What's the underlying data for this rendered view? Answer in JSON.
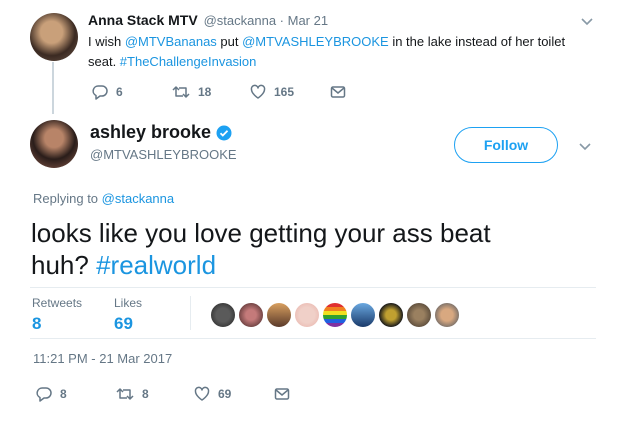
{
  "parent_tweet": {
    "display_name": "Anna Stack MTV",
    "handle": "@stackanna",
    "separator": " · ",
    "date": "Mar 21",
    "text_line1_prefix": "I wish ",
    "mention1": "@MTVBananas",
    "text_mid": " put ",
    "mention2": "@MTVASHLEYBROOKE",
    "text_line1_suffix": " in the lake instead of her toilet",
    "text_line2_prefix": "seat. ",
    "hashtag": "#TheChallengeInvasion",
    "reply_count": "6",
    "retweet_count": "18",
    "like_count": "165"
  },
  "main_tweet": {
    "display_name": "ashley brooke",
    "handle": "@MTVASHLEYBROOKE",
    "follow_label": "Follow",
    "replying_prefix": "Replying to ",
    "replying_handle": "@stackanna",
    "text_line1": "looks like you love getting your ass beat",
    "text_line2_prefix": "huh? ",
    "hashtag": "#realworld",
    "stats": {
      "retweets_label": "Retweets",
      "retweets_value": "8",
      "likes_label": "Likes",
      "likes_value": "69"
    },
    "timestamp": "11:21 PM - 21 Mar 2017",
    "reply_count": "8",
    "retweet_count": "8",
    "like_count": "69"
  },
  "colors": {
    "accent": "#1b95e0",
    "follow_border": "#1da1f2",
    "muted": "#657786",
    "verified": "#1da1f2"
  },
  "icons": [
    "chevron-down-icon",
    "reply-icon",
    "retweet-icon",
    "like-icon",
    "message-icon",
    "verified-icon"
  ]
}
